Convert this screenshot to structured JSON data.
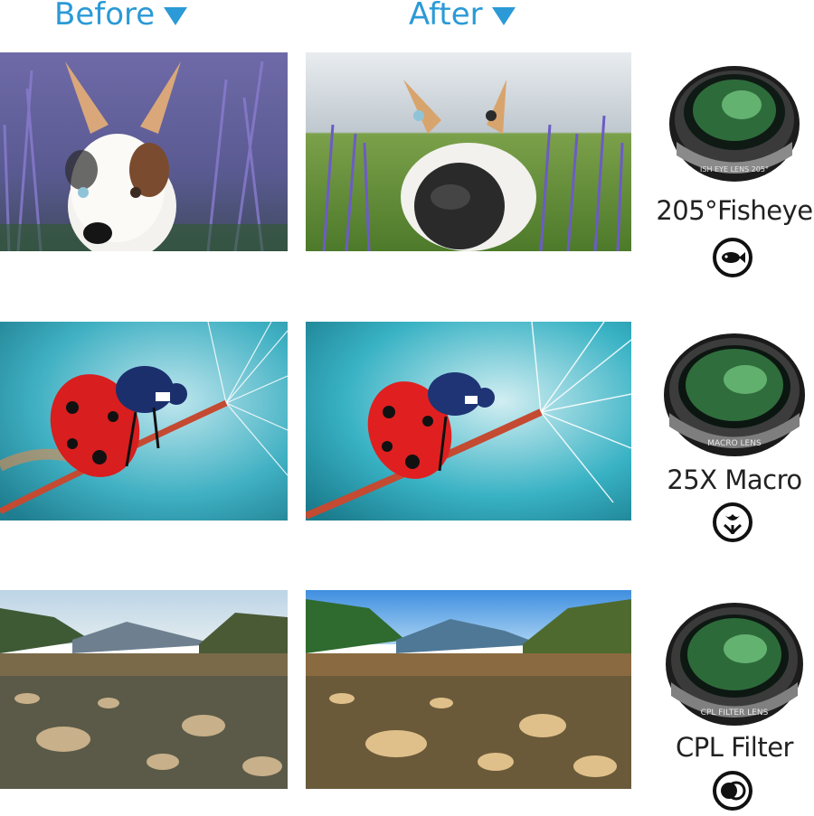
{
  "header": {
    "before_label": "Before",
    "after_label": "After"
  },
  "rows": [
    {
      "lens_label": "205°Fisheye",
      "lens_ring_text": "ISH EYE LENS 205°",
      "icon": "fisheye-mode-icon"
    },
    {
      "lens_label": "25X Macro",
      "lens_ring_text": "MACRO LENS",
      "icon": "macro-tulip-icon"
    },
    {
      "lens_label": "CPL Filter",
      "lens_ring_text": "CPL FILTER LENS",
      "icon": "cpl-filter-icon"
    }
  ],
  "colors": {
    "accent": "#2b9ad6",
    "text": "#222222"
  }
}
